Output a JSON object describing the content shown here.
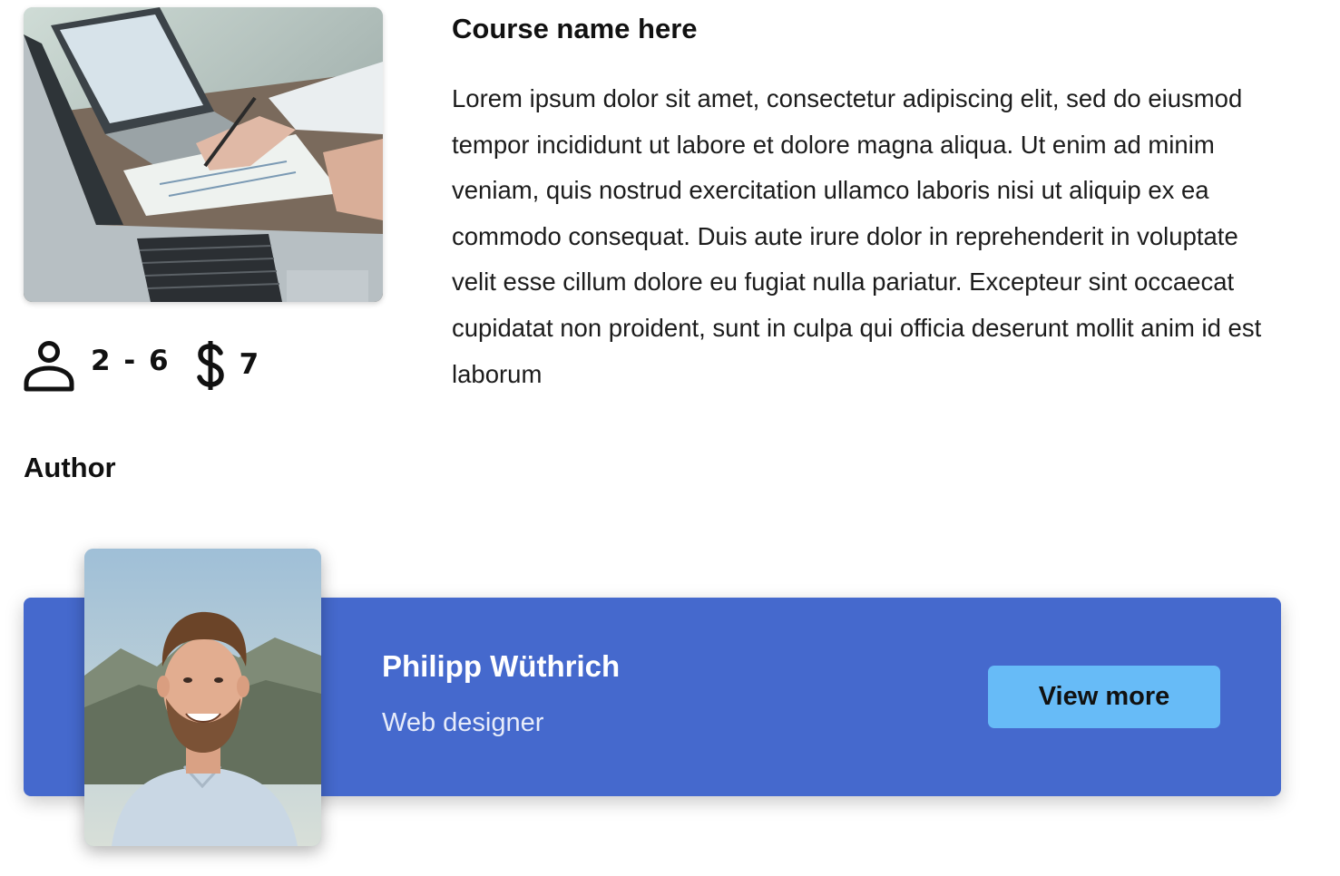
{
  "course": {
    "title": "Course name here",
    "description": "Lorem ipsum dolor sit amet, consectetur adipiscing elit, sed do eiusmod tempor incididunt ut labore et dolore magna aliqua. Ut enim ad minim veniam, quis nostrud exercitation ullamco laboris nisi ut aliquip ex ea commodo consequat. Duis aute irure dolor in reprehenderit in voluptate velit esse cillum dolore eu fugiat nulla pariatur. Excepteur sint occaecat cupidatat non proident, sunt in culpa qui officia deserunt mollit anim id est laborum",
    "image_icon": "laptop-meeting-photo",
    "participants_icon": "person-icon",
    "participants": "2 - 6",
    "price_icon": "dollar-icon",
    "price": "7"
  },
  "author": {
    "heading": "Author",
    "name": "Philipp Wüthrich",
    "role": "Web designer",
    "photo_icon": "author-portrait-photo",
    "view_more_label": "View more"
  },
  "colors": {
    "card_background": "#4569cd",
    "button_background": "#67bbf7",
    "text_primary": "#111111",
    "card_text": "#ffffff"
  }
}
